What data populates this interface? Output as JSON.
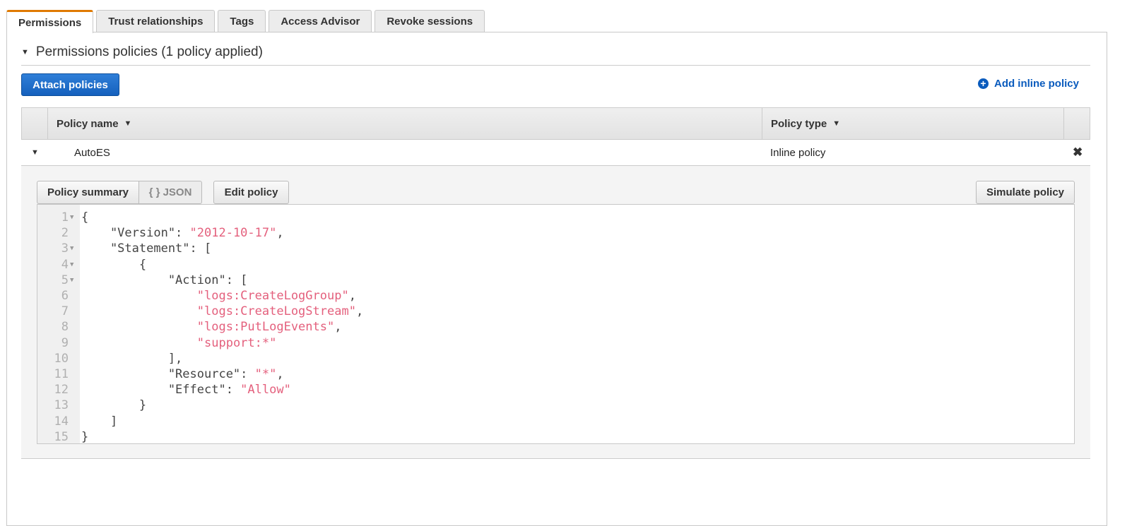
{
  "tabs": [
    {
      "label": "Permissions",
      "active": true
    },
    {
      "label": "Trust relationships"
    },
    {
      "label": "Tags"
    },
    {
      "label": "Access Advisor"
    },
    {
      "label": "Revoke sessions"
    }
  ],
  "section": {
    "title": "Permissions policies (1 policy applied)"
  },
  "attach_label": "Attach policies",
  "add_inline_label": "Add inline policy",
  "table": {
    "columns": [
      "Policy name",
      "Policy type"
    ],
    "rows": [
      {
        "name": "AutoES",
        "type": "Inline policy"
      }
    ]
  },
  "detail": {
    "policy_summary": "Policy summary",
    "json_tab": "{ } JSON",
    "edit_policy": "Edit policy",
    "simulate_policy": "Simulate policy"
  },
  "code_lines": [
    {
      "n": "1",
      "fold": true,
      "t": "{"
    },
    {
      "n": "2",
      "t": "    \"Version\": ",
      "s": "\"2012-10-17\"",
      "e": ","
    },
    {
      "n": "3",
      "fold": true,
      "t": "    \"Statement\": ["
    },
    {
      "n": "4",
      "fold": true,
      "t": "        {"
    },
    {
      "n": "5",
      "fold": true,
      "t": "            \"Action\": ["
    },
    {
      "n": "6",
      "t": "                ",
      "s": "\"logs:CreateLogGroup\"",
      "e": ","
    },
    {
      "n": "7",
      "t": "                ",
      "s": "\"logs:CreateLogStream\"",
      "e": ","
    },
    {
      "n": "8",
      "t": "                ",
      "s": "\"logs:PutLogEvents\"",
      "e": ","
    },
    {
      "n": "9",
      "t": "                ",
      "s": "\"support:*\""
    },
    {
      "n": "10",
      "t": "            ],"
    },
    {
      "n": "11",
      "t": "            \"Resource\": ",
      "s": "\"*\"",
      "e": ","
    },
    {
      "n": "12",
      "t": "            \"Effect\": ",
      "s": "\"Allow\""
    },
    {
      "n": "13",
      "t": "        }"
    },
    {
      "n": "14",
      "t": "    ]"
    },
    {
      "n": "15",
      "t": "}"
    }
  ],
  "colors": {
    "accent": "#e07a00",
    "primary": "#1560bd",
    "link": "#0a5bbd",
    "string": "#e4607d"
  }
}
